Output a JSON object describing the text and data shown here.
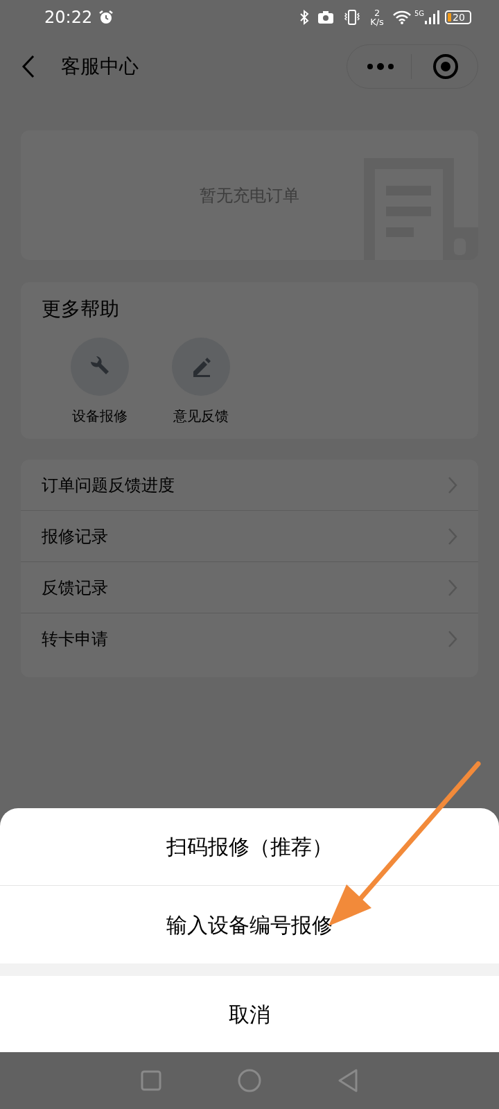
{
  "status_bar": {
    "time": "20:22",
    "net_speed_value": "2",
    "net_speed_unit": "K/s",
    "network": "5G",
    "battery": "20"
  },
  "header": {
    "title": "客服中心"
  },
  "orders_card": {
    "empty_text": "暂无充电订单"
  },
  "help": {
    "title": "更多帮助",
    "items": [
      {
        "label": "设备报修",
        "kind": "wrench"
      },
      {
        "label": "意见反馈",
        "kind": "pen"
      }
    ]
  },
  "menu": [
    {
      "label": "订单问题反馈进度"
    },
    {
      "label": "报修记录"
    },
    {
      "label": "反馈记录"
    },
    {
      "label": "转卡申请"
    }
  ],
  "action_sheet": {
    "options": [
      "扫码报修（推荐）",
      "输入设备编号报修"
    ],
    "cancel": "取消"
  }
}
